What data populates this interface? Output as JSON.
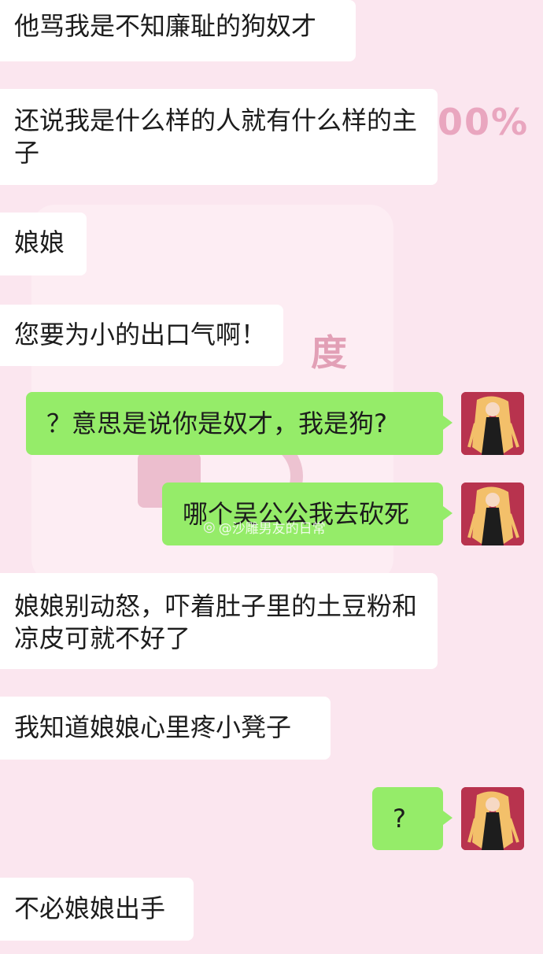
{
  "chat": {
    "messages": [
      {
        "side": "left",
        "text": "他骂我是不知廉耻的狗奴才"
      },
      {
        "side": "left",
        "text": "还说我是什么样的人就有什么样的主子"
      },
      {
        "side": "left",
        "text": "娘娘"
      },
      {
        "side": "left",
        "text": "您要为小的出口气啊！"
      },
      {
        "side": "right",
        "text": "？意思是说你是奴才，我是狗?"
      },
      {
        "side": "right",
        "text": "哪个吴公公我去砍死"
      },
      {
        "side": "left",
        "text": "娘娘别动怒，吓着肚子里的土豆粉和凉皮可就不好了"
      },
      {
        "side": "left",
        "text": "我知道娘娘心里疼小凳子"
      },
      {
        "side": "right",
        "text": "?"
      },
      {
        "side": "left",
        "text": "不必娘娘出手"
      }
    ]
  },
  "background": {
    "percent_text": "00%",
    "char_text": "度"
  },
  "watermark": {
    "text": "@沙雕男友的日常",
    "icon": "weibo-icon"
  },
  "colors": {
    "background": "#fbe6ef",
    "left_bubble": "#ffffff",
    "right_bubble": "#95ec69"
  }
}
